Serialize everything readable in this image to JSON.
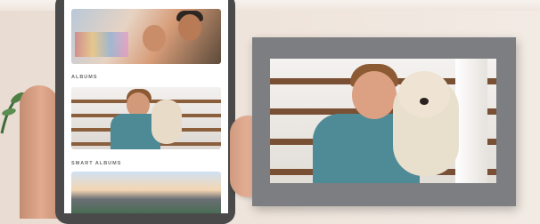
{
  "phone": {
    "sections": {
      "albums": "ALBUMS",
      "smart_albums": "SMART ALBUMS"
    }
  }
}
